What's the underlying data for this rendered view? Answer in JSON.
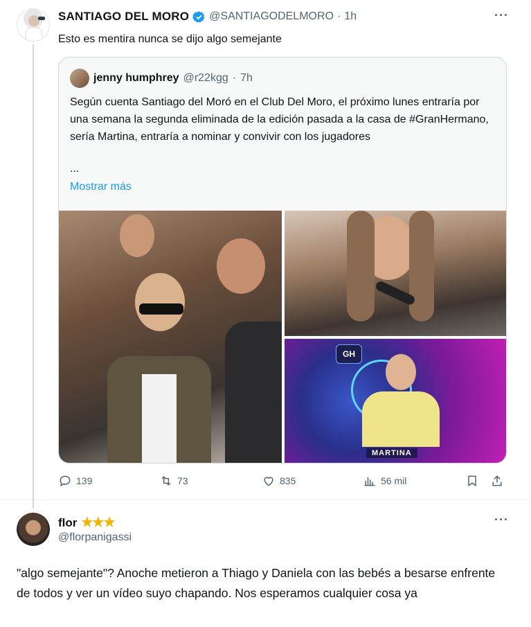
{
  "main_tweet": {
    "name": "SANTIAGO DEL MORO",
    "handle": "@SANTIAGODELMORO",
    "time": "1h",
    "separator": "·",
    "more": "···",
    "text": "Esto es mentira nunca se dijo algo semejante"
  },
  "quoted_tweet": {
    "name": "jenny humphrey",
    "handle": "@r22kgg",
    "time": "7h",
    "separator": "·",
    "text": "Según cuenta Santiago del Moró en el Club Del Moro, el próximo lunes entraría por una semana la segunda eliminada de la edición pasada a la casa de #GranHermano, sería Martina, entraría a nominar y convivir con los jugadores",
    "ellipsis": "...",
    "show_more": "Mostrar más",
    "media_badge": "GH",
    "media_caption": "MARTINA"
  },
  "actions": {
    "replies": "139",
    "retweets": "73",
    "likes": "835",
    "views": "56 mil",
    "icons": [
      "reply-icon",
      "retweet-icon",
      "like-icon",
      "views-icon",
      "bookmark-icon",
      "share-icon"
    ]
  },
  "reply": {
    "name": "flor",
    "stars": "★★★",
    "handle": "@florpanigassi",
    "more": "···",
    "text": "\"algo semejante\"? Anoche metieron a Thiago y Daniela con las bebés a besarse enfrente de todos y ver un vídeo suyo chapando. Nos esperamos cualquier cosa ya"
  },
  "colors": {
    "verified": "#1d9bf0",
    "link": "#1d9bf0",
    "secondary_text": "#536471",
    "star": "#f5b400"
  }
}
